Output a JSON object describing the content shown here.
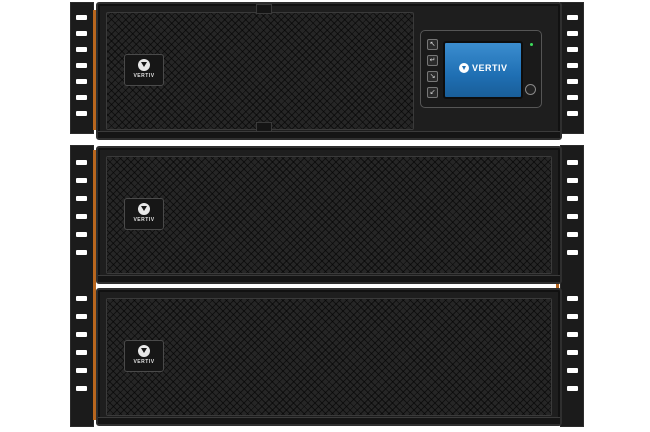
{
  "product": {
    "brand": "VERTIV",
    "screen_brand": "VERTIV",
    "modules": [
      {
        "role": "ups-module",
        "badge": "VERTIV"
      },
      {
        "role": "battery-module",
        "badge": "VERTIV"
      },
      {
        "role": "battery-module",
        "badge": "VERTIV"
      }
    ]
  },
  "panel": {
    "keys": [
      "↖",
      "↵",
      "↘",
      "↙"
    ]
  },
  "colors": {
    "chassis": "#1e1e1e",
    "mesh": "#262626",
    "screen": "#1f6fb3",
    "accent_edge": "#b8661e",
    "status_led": "#3ddc5c"
  }
}
